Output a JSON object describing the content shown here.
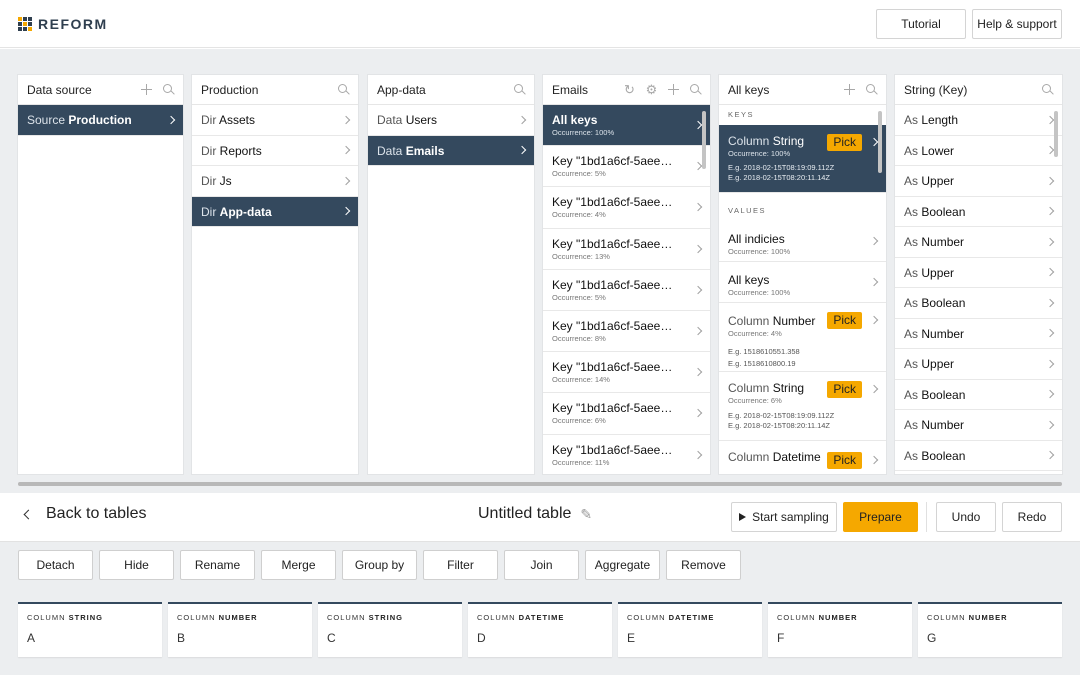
{
  "header": {
    "logo_text": "REFORM",
    "tutorial_label": "Tutorial",
    "help_label": "Help & support"
  },
  "panels": {
    "data_source": {
      "title": "Data source",
      "items": [
        {
          "prefix": "Source",
          "name": "Production"
        }
      ]
    },
    "production": {
      "title": "Production",
      "items": [
        {
          "prefix": "Dir",
          "name": "Assets"
        },
        {
          "prefix": "Dir",
          "name": "Reports"
        },
        {
          "prefix": "Dir",
          "name": "Js"
        },
        {
          "prefix": "Dir",
          "name": "App-data"
        }
      ]
    },
    "app_data": {
      "title": "App-data",
      "items": [
        {
          "prefix": "Data",
          "name": "Users"
        },
        {
          "prefix": "Data",
          "name": "Emails"
        }
      ]
    },
    "emails": {
      "title": "Emails",
      "items": [
        {
          "label": "All keys",
          "occ": "Occurrence: 100%"
        },
        {
          "label": "Key \"1bd1a6cf-5aee…",
          "occ": "Occurrence: 5%"
        },
        {
          "label": "Key \"1bd1a6cf-5aee…",
          "occ": "Occurrence: 4%"
        },
        {
          "label": "Key \"1bd1a6cf-5aee…",
          "occ": "Occurrence: 13%"
        },
        {
          "label": "Key \"1bd1a6cf-5aee…",
          "occ": "Occurrence: 5%"
        },
        {
          "label": "Key \"1bd1a6cf-5aee…",
          "occ": "Occurrence: 8%"
        },
        {
          "label": "Key \"1bd1a6cf-5aee…",
          "occ": "Occurrence: 14%"
        },
        {
          "label": "Key \"1bd1a6cf-5aee…",
          "occ": "Occurrence: 6%"
        },
        {
          "label": "Key \"1bd1a6cf-5aee…",
          "occ": "Occurrence: 11%"
        }
      ]
    },
    "all_keys": {
      "title": "All keys",
      "keys_section": "KEYS",
      "values_section": "VALUES",
      "pick_label": "Pick",
      "key_item": {
        "prefix": "Column",
        "name": "String",
        "occ": "Occurrence: 100%",
        "eg1": "E.g. 2018-02-15T08:19:09.112Z",
        "eg2": "E.g. 2018-02-15T08:20:11.14Z"
      },
      "values": [
        {
          "label": "All indicies",
          "occ": "Occurrence: 100%"
        },
        {
          "label": "All keys",
          "occ": "Occurrence: 100%"
        },
        {
          "prefix": "Column",
          "name": "Number",
          "occ": "Occurrence: 4%",
          "eg1": "E.g. 1518610551.358",
          "eg2": "E.g. 1518610800.19"
        },
        {
          "prefix": "Column",
          "name": "String",
          "occ": "Occurrence: 6%",
          "eg1": "E.g. 2018-02-15T08:19:09.112Z",
          "eg2": "E.g. 2018-02-15T08:20:11.14Z"
        },
        {
          "prefix": "Column",
          "name": "Datetime"
        }
      ]
    },
    "string_key": {
      "title": "String (Key)",
      "items": [
        {
          "prefix": "As",
          "name": "Length"
        },
        {
          "prefix": "As",
          "name": "Lower"
        },
        {
          "prefix": "As",
          "name": "Upper"
        },
        {
          "prefix": "As",
          "name": "Boolean"
        },
        {
          "prefix": "As",
          "name": "Number"
        },
        {
          "prefix": "As",
          "name": "Upper"
        },
        {
          "prefix": "As",
          "name": "Boolean"
        },
        {
          "prefix": "As",
          "name": "Number"
        },
        {
          "prefix": "As",
          "name": "Upper"
        },
        {
          "prefix": "As",
          "name": "Boolean"
        },
        {
          "prefix": "As",
          "name": "Number"
        },
        {
          "prefix": "As",
          "name": "Boolean"
        }
      ]
    }
  },
  "toolbar": {
    "back_label": "Back to tables",
    "table_title": "Untitled table",
    "start_sampling_label": "Start sampling",
    "prepare_label": "Prepare",
    "undo_label": "Undo",
    "redo_label": "Redo"
  },
  "operations": [
    "Detach",
    "Hide",
    "Rename",
    "Merge",
    "Group by",
    "Filter",
    "Join",
    "Aggregate",
    "Remove"
  ],
  "columns": [
    {
      "prefix": "COLUMN",
      "type": "STRING",
      "name": "A"
    },
    {
      "prefix": "COLUMN",
      "type": "NUMBER",
      "name": "B"
    },
    {
      "prefix": "COLUMN",
      "type": "STRING",
      "name": "C"
    },
    {
      "prefix": "COLUMN",
      "type": "DATETIME",
      "name": "D"
    },
    {
      "prefix": "COLUMN",
      "type": "DATETIME",
      "name": "E"
    },
    {
      "prefix": "COLUMN",
      "type": "NUMBER",
      "name": "F"
    },
    {
      "prefix": "COLUMN",
      "type": "NUMBER",
      "name": "G"
    }
  ],
  "colors": {
    "accent": "#f5a800",
    "selected": "#34495e"
  }
}
